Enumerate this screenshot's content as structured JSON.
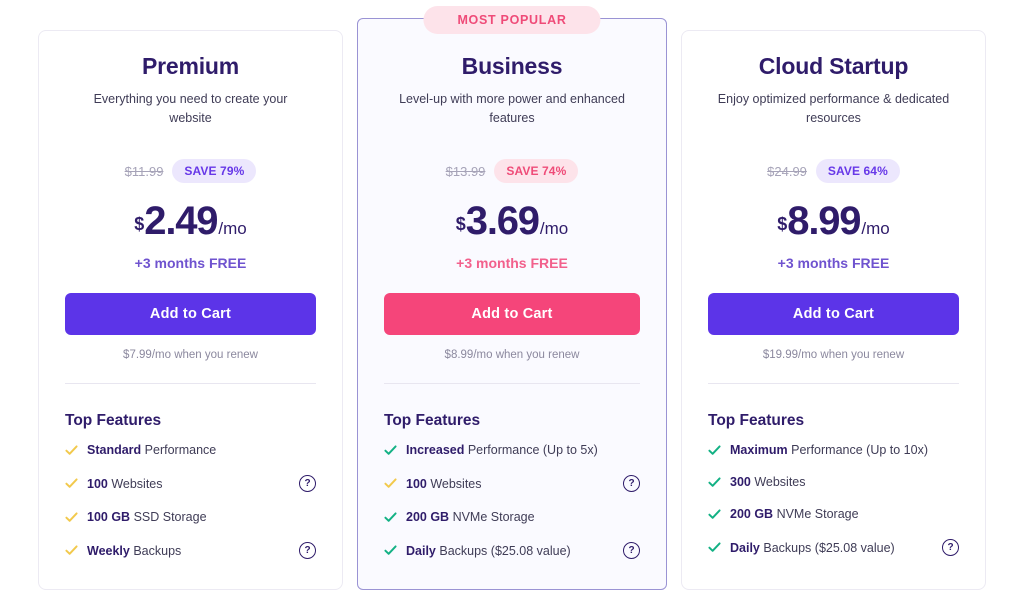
{
  "page": {
    "background": "#ffffff",
    "accent_purple": "#5c34e8",
    "accent_pink": "#f5457a",
    "heading_color": "#2f1c6a"
  },
  "plans": [
    {
      "id": "premium",
      "name": "Premium",
      "description": "Everything you need to create your website",
      "featured": false,
      "badge": null,
      "old_price": "$11.99",
      "save_label": "SAVE 79%",
      "currency": "$",
      "amount": "2.49",
      "period": "/mo",
      "promo": "+3 months FREE",
      "cta_label": "Add to Cart",
      "renew_note": "$7.99/mo when you renew",
      "features_title": "Top Features",
      "check_color": "#f2c94c",
      "features": [
        {
          "bold": "Standard",
          "rest": " Performance",
          "help": false,
          "check_color": "#f2c94c"
        },
        {
          "bold": "100",
          "rest": " Websites",
          "help": true,
          "check_color": "#f2c94c"
        },
        {
          "bold": "100 GB",
          "rest": " SSD Storage",
          "help": false,
          "check_color": "#f2c94c"
        },
        {
          "bold": "Weekly",
          "rest": " Backups",
          "help": true,
          "check_color": "#f2c94c"
        }
      ]
    },
    {
      "id": "business",
      "name": "Business",
      "description": "Level-up with more power and enhanced features",
      "featured": true,
      "badge": "MOST POPULAR",
      "old_price": "$13.99",
      "save_label": "SAVE 74%",
      "currency": "$",
      "amount": "3.69",
      "period": "/mo",
      "promo": "+3 months FREE",
      "cta_label": "Add to Cart",
      "renew_note": "$8.99/mo when you renew",
      "features_title": "Top Features",
      "check_color": "#13b184",
      "features": [
        {
          "bold": "Increased",
          "rest": " Performance (Up to 5x)",
          "help": false,
          "check_color": "#13b184"
        },
        {
          "bold": "100",
          "rest": " Websites",
          "help": true,
          "check_color": "#f2c94c"
        },
        {
          "bold": "200 GB",
          "rest": " NVMe Storage",
          "help": false,
          "check_color": "#13b184"
        },
        {
          "bold": "Daily",
          "rest": " Backups ($25.08 value)",
          "help": true,
          "check_color": "#13b184"
        }
      ]
    },
    {
      "id": "cloud-startup",
      "name": "Cloud Startup",
      "description": "Enjoy optimized performance & dedicated resources",
      "featured": false,
      "badge": null,
      "old_price": "$24.99",
      "save_label": "SAVE 64%",
      "currency": "$",
      "amount": "8.99",
      "period": "/mo",
      "promo": "+3 months FREE",
      "cta_label": "Add to Cart",
      "renew_note": "$19.99/mo when you renew",
      "features_title": "Top Features",
      "check_color": "#13b184",
      "features": [
        {
          "bold": "Maximum",
          "rest": " Performance (Up to 10x)",
          "help": false,
          "check_color": "#13b184"
        },
        {
          "bold": "300",
          "rest": " Websites",
          "help": false,
          "check_color": "#13b184"
        },
        {
          "bold": "200 GB",
          "rest": " NVMe Storage",
          "help": false,
          "check_color": "#13b184"
        },
        {
          "bold": "Daily",
          "rest": " Backups ($25.08 value)",
          "help": true,
          "check_color": "#13b184"
        }
      ]
    }
  ],
  "icons": {
    "check": "check-icon",
    "help": "?"
  }
}
